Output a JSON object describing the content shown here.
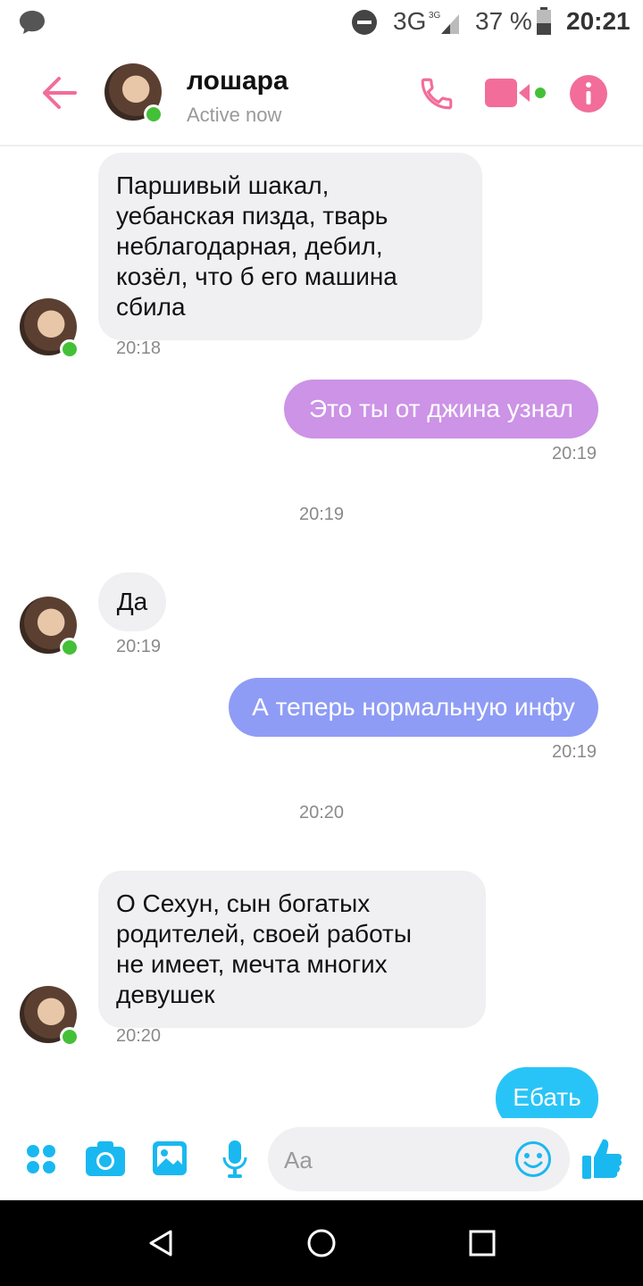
{
  "status_bar": {
    "network": "3G",
    "battery": "37 %",
    "time": "20:21"
  },
  "header": {
    "contact_name": "лошара",
    "status": "Active now"
  },
  "messages": [
    {
      "text_lines": [
        "Паршивый шакал,",
        "уебанская пизда, тварь",
        "неблагодарная, дебил,",
        "козёл, что б его машина",
        "сбила"
      ],
      "time": "20:18"
    },
    {
      "text": "Это ты от джина узнал",
      "time": "20:19"
    },
    {
      "text": "Да",
      "time": "20:19"
    },
    {
      "text": "А теперь нормальную инфу",
      "time": "20:19"
    },
    {
      "text_lines": [
        "О Сехун, сын богатых",
        "родителей, своей работы",
        "не имеет, мечта многих",
        "девушек"
      ],
      "time": "20:20"
    },
    {
      "text": "Ебать"
    }
  ],
  "separators": [
    "20:19",
    "20:20"
  ],
  "composer": {
    "placeholder": "Aa"
  },
  "colors": {
    "accent_pink": "#f26d9a",
    "bubble_violet": "#cc93e6",
    "bubble_periwinkle": "#8f9cf5",
    "bubble_cyan": "#29c4f7",
    "incoming_bg": "#f0eff2",
    "icon_cyan": "#1ab8f0"
  }
}
